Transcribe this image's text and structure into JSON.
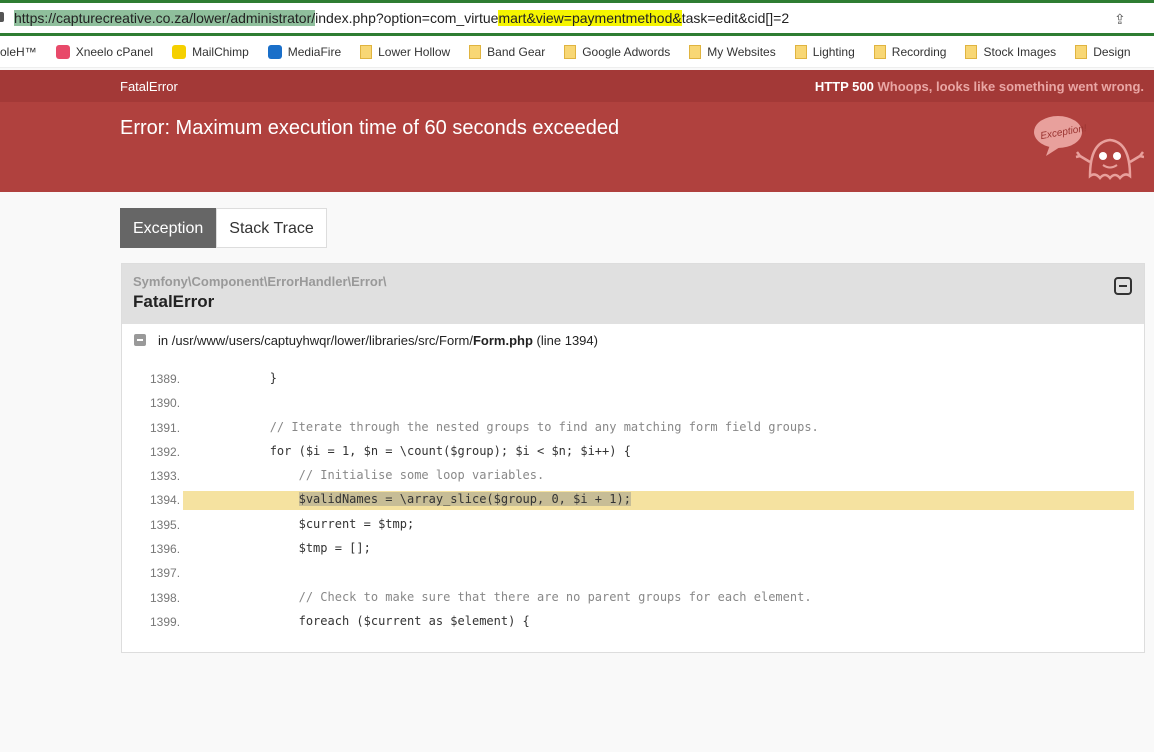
{
  "browser": {
    "url_parts": [
      "https://capturecreative.co.za/lower/administrator/",
      "index.php?option=com_virtue",
      "mart&view=paymentmethod&",
      "task=edit&cid[]=2"
    ],
    "bookmarks": [
      {
        "label": "oleH™",
        "type": "none"
      },
      {
        "label": "Xneelo cPanel",
        "type": "xneelo"
      },
      {
        "label": "MailChimp",
        "type": "mailchimp"
      },
      {
        "label": "MediaFire",
        "type": "mediafire"
      },
      {
        "label": "Lower Hollow",
        "type": "folder"
      },
      {
        "label": "Band Gear",
        "type": "folder"
      },
      {
        "label": "Google Adwords",
        "type": "folder"
      },
      {
        "label": "My Websites",
        "type": "folder"
      },
      {
        "label": "Lighting",
        "type": "folder"
      },
      {
        "label": "Recording",
        "type": "folder"
      },
      {
        "label": "Stock Images",
        "type": "folder"
      },
      {
        "label": "Design",
        "type": "folder"
      }
    ]
  },
  "topbar": {
    "title": "FatalError",
    "status": "HTTP 500",
    "message": "Whoops, looks like something went wrong."
  },
  "error": {
    "message": "Error: Maximum execution time of 60 seconds exceeded",
    "mascot_text": "Exception!"
  },
  "tabs": [
    {
      "label": "Exception",
      "active": true
    },
    {
      "label": "Stack Trace",
      "active": false
    }
  ],
  "exception": {
    "namespace": "Symfony\\Component\\ErrorHandler\\Error\\",
    "class": "FatalError",
    "file_prefix": "in /usr/www/users/captuyhwqr/lower/libraries/src/Form/",
    "file_name": "Form.php",
    "line_info": "(line 1394)"
  },
  "code": [
    {
      "no": "1389.",
      "text": "            }"
    },
    {
      "no": "1390.",
      "text": ""
    },
    {
      "no": "1391.",
      "text": "            // Iterate through the nested groups to find any matching form field groups.",
      "comment": true
    },
    {
      "no": "1392.",
      "text": "            for ($i = 1, $n = \\count($group); $i < $n; $i++) {"
    },
    {
      "no": "1393.",
      "text": "                // Initialise some loop variables.",
      "comment": true
    },
    {
      "no": "1394.",
      "text": "                $validNames = \\array_slice($group, 0, $i + 1);",
      "highlight": true
    },
    {
      "no": "1395.",
      "text": "                $current = $tmp;"
    },
    {
      "no": "1396.",
      "text": "                $tmp = [];"
    },
    {
      "no": "1397.",
      "text": ""
    },
    {
      "no": "1398.",
      "text": "                // Check to make sure that there are no parent groups for each element.",
      "comment": true
    },
    {
      "no": "1399.",
      "text": "                foreach ($current as $element) {"
    }
  ]
}
